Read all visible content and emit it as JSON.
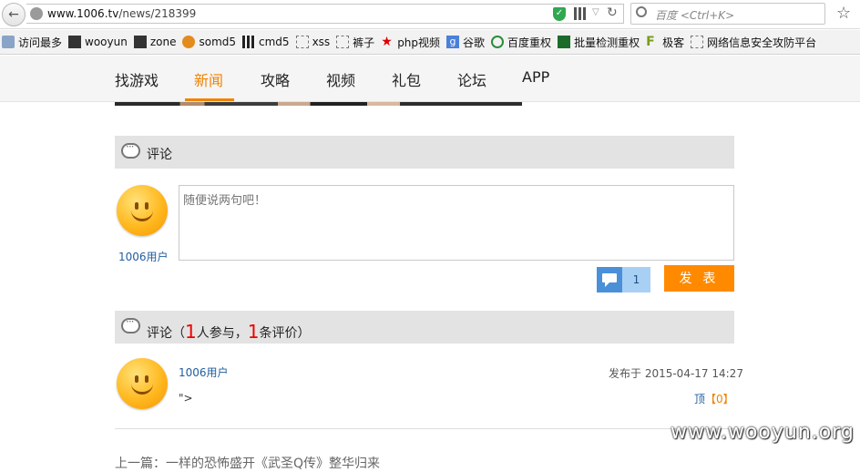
{
  "browser": {
    "url_host": "www.1006.tv",
    "url_path": "/news/218399",
    "search_placeholder": "百度 <Ctrl+K>"
  },
  "bookmarks": [
    {
      "label": "访问最多",
      "icon": "folder-icon"
    },
    {
      "label": "wooyun",
      "icon": "wooyun-icon"
    },
    {
      "label": "zone",
      "icon": "wooyun-icon"
    },
    {
      "label": "somd5",
      "icon": "somd5-icon"
    },
    {
      "label": "cmd5",
      "icon": "grid-icon"
    },
    {
      "label": "xss",
      "icon": "blank-page-icon"
    },
    {
      "label": "裤子",
      "icon": "blank-page-icon"
    },
    {
      "label": "php视频",
      "icon": "red-star-icon"
    },
    {
      "label": "谷歌",
      "icon": "google-icon"
    },
    {
      "label": "百度重权",
      "icon": "refresh-icon"
    },
    {
      "label": "批量检测重权",
      "icon": "building-icon"
    },
    {
      "label": "极客",
      "icon": "f-logo-icon"
    },
    {
      "label": "网络信息安全攻防平台",
      "icon": "blank-page-icon"
    }
  ],
  "nav": {
    "items": [
      "找游戏",
      "新闻",
      "攻略",
      "视频",
      "礼包",
      "论坛",
      "APP"
    ],
    "active": "新闻"
  },
  "comment_form": {
    "section_title": "评论",
    "user_name": "1006用户",
    "textarea_placeholder": "随便说两句吧！",
    "comment_count": "1",
    "submit_label": "发 表"
  },
  "comments_section": {
    "prefix": "评论（",
    "participants": "1",
    "middle": "人参与，",
    "reviews": "1",
    "suffix": "条评价）"
  },
  "comments": [
    {
      "user": "1006用户",
      "date": "发布于 2015-04-17 14:27",
      "body": "\">",
      "up_label": "顶",
      "up_count": "【0】"
    }
  ],
  "next_article": "上一篇：一样的恐怖盛开《武圣Q传》整华归来",
  "watermark": "www.wooyun.org"
}
